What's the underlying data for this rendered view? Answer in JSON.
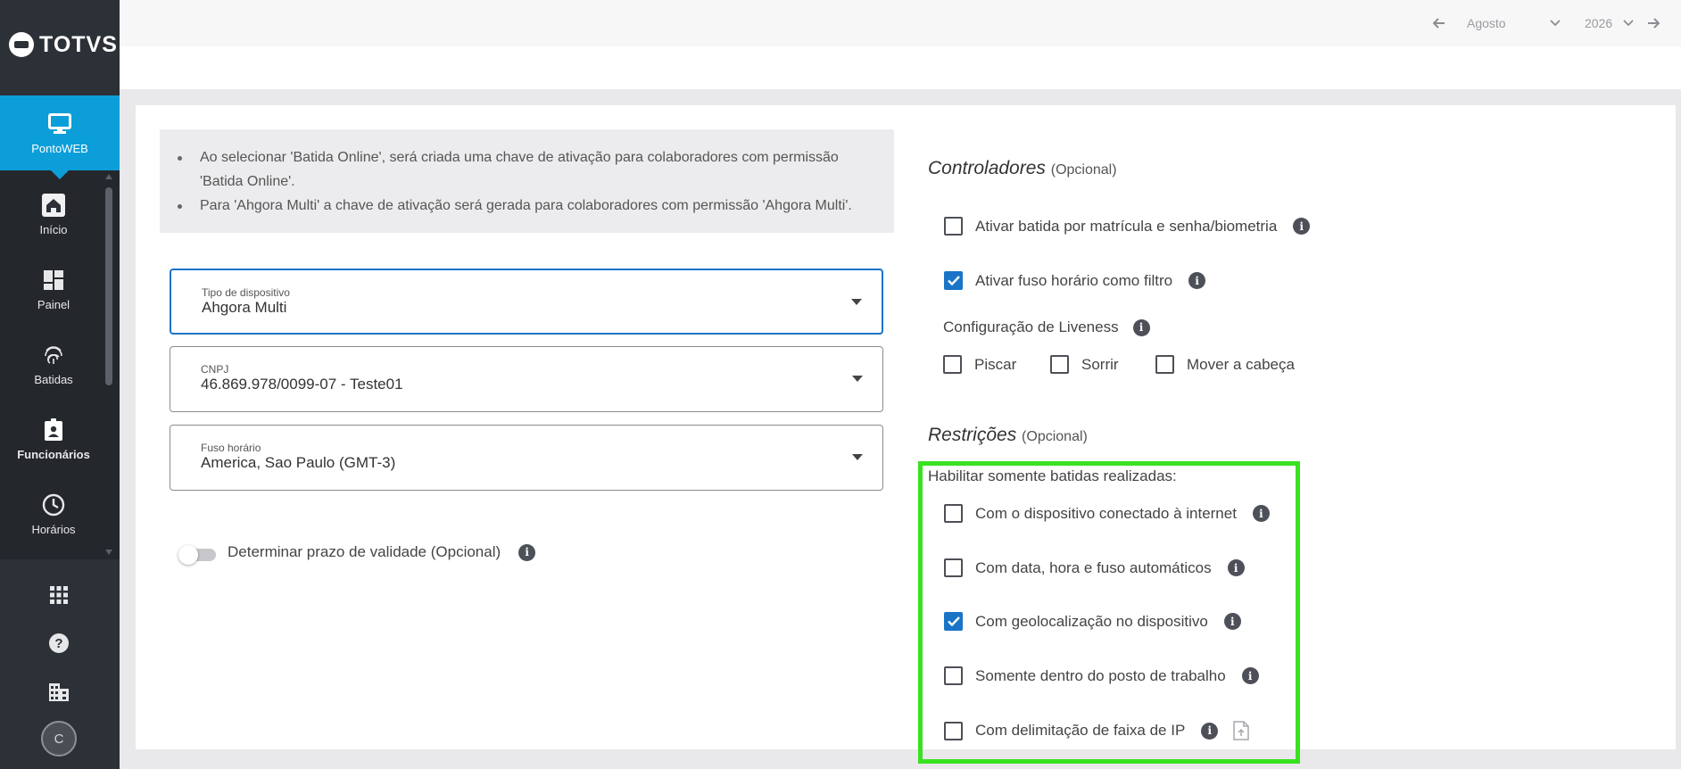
{
  "sidebar": {
    "logo": "TOTVS",
    "items": [
      {
        "label": "PontoWEB",
        "icon": "monitor-icon",
        "active": true
      },
      {
        "label": "Início",
        "icon": "home-icon"
      },
      {
        "label": "Painel",
        "icon": "dashboard-icon"
      },
      {
        "label": "Batidas",
        "icon": "fingerprint-icon"
      },
      {
        "label": "Funcionários",
        "icon": "badge-icon"
      },
      {
        "label": "Horários",
        "icon": "clock-icon"
      }
    ],
    "bottom_icons": [
      "apps-grid-icon",
      "help-icon",
      "building-icon"
    ],
    "avatar_initial": "C"
  },
  "topbar": {
    "month": "Agosto",
    "year": "2026"
  },
  "info_box": {
    "lines": [
      "Ao selecionar 'Batida Online', será criada uma chave de ativação para colaboradores com permissão 'Batida Online'.",
      "Para 'Ahgora Multi' a chave de ativação será gerada para colaboradores com permissão 'Ahgora Multi'."
    ]
  },
  "form": {
    "device_type": {
      "label": "Tipo de dispositivo",
      "value": "Ahgora Multi"
    },
    "cnpj": {
      "label": "CNPJ",
      "value": "46.869.978/0099-07 - Teste01"
    },
    "timezone": {
      "label": "Fuso horário",
      "value": "America, Sao Paulo (GMT-3)"
    },
    "validity_toggle": {
      "label": "Determinar prazo de validade (Opcional)",
      "on": false
    }
  },
  "controllers": {
    "title": "Controladores",
    "optional": "(Opcional)",
    "options": [
      {
        "label": "Ativar batida por matrícula e senha/biometria",
        "checked": false
      },
      {
        "label": "Ativar fuso horário como filtro",
        "checked": true
      }
    ],
    "liveness": {
      "label": "Configuração de Liveness",
      "options": [
        {
          "label": "Piscar",
          "checked": false
        },
        {
          "label": "Sorrir",
          "checked": false
        },
        {
          "label": "Mover a cabeça",
          "checked": false
        }
      ]
    }
  },
  "restrictions": {
    "title": "Restrições",
    "optional": "(Opcional)",
    "subtitle": "Habilitar somente batidas realizadas:",
    "options": [
      {
        "label": "Com o dispositivo conectado à internet",
        "checked": false
      },
      {
        "label": "Com data, hora e fuso automáticos",
        "checked": false
      },
      {
        "label": "Com geolocalização no dispositivo",
        "checked": true
      },
      {
        "label": "Somente dentro do posto de trabalho",
        "checked": false
      },
      {
        "label": "Com delimitação de faixa de IP",
        "checked": false
      }
    ]
  },
  "colors": {
    "accent": "#0c9ed9",
    "checkbox_checked": "#1a74c7",
    "highlight": "#39e121"
  }
}
